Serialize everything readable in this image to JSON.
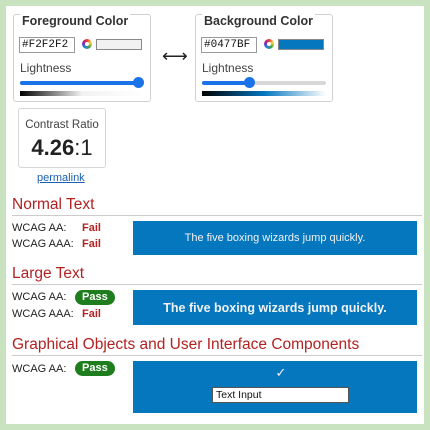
{
  "foreground": {
    "title": "Foreground Color",
    "hex": "#F2F2F2",
    "color": "#f2f2f2",
    "lightness_label": "Lightness",
    "lightness": 0.95,
    "gradient": "linear-gradient(to right,#000000,#f2f2f2,#ffffff)"
  },
  "background": {
    "title": "Background Color",
    "hex": "#0477BF",
    "color": "#0477bf",
    "lightness_label": "Lightness",
    "lightness": 0.38,
    "gradient": "linear-gradient(to right,#000000,#0477bf,#ffffff)"
  },
  "swap_icon": "⟷",
  "contrast": {
    "label": "Contrast Ratio",
    "value": "4.26",
    "suffix": ":1"
  },
  "permalink": "permalink",
  "normal_text": {
    "title": "Normal Text",
    "aa_label": "WCAG AA:",
    "aa_result": "Fail",
    "aaa_label": "WCAG AAA:",
    "aaa_result": "Fail",
    "sample": "The five boxing wizards jump quickly."
  },
  "large_text": {
    "title": "Large Text",
    "aa_label": "WCAG AA:",
    "aa_result": "Pass",
    "aaa_label": "WCAG AAA:",
    "aaa_result": "Fail",
    "sample": "The five boxing wizards jump quickly."
  },
  "graphical": {
    "title": "Graphical Objects and User Interface Components",
    "aa_label": "WCAG AA:",
    "aa_result": "Pass",
    "check_icon": "✓",
    "input_value": "Text Input"
  },
  "colors": {
    "fail": "#b22222",
    "pass": "#1e7e1e",
    "accent": "#1a73e8"
  }
}
